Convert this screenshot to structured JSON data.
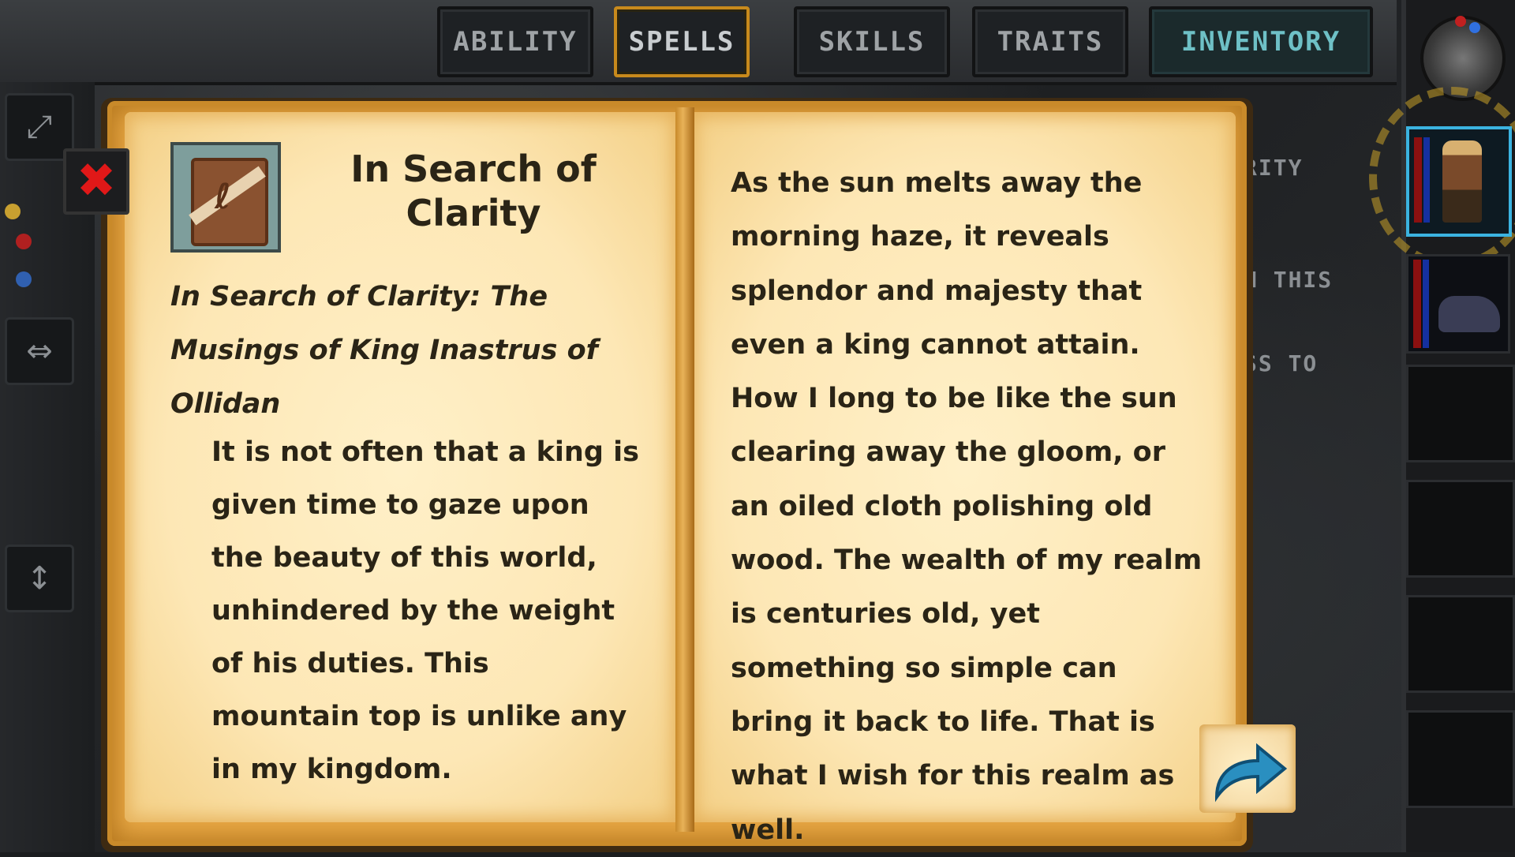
{
  "tabs": [
    {
      "label": "ABILITY",
      "active": false
    },
    {
      "label": "SPELLS",
      "active": true
    },
    {
      "label": "SKILLS",
      "active": false
    },
    {
      "label": "TRAITS",
      "active": false
    },
    {
      "label": "INVENTORY",
      "active": false
    }
  ],
  "background_panel": {
    "line1": "RITY",
    "line2": "N THIS",
    "line3": "SS TO"
  },
  "left_sidebar": {
    "expand_icon": "expand-icon",
    "resize_icon": "resize-horizontal-icon",
    "sort_icon": "sort-lines-icon"
  },
  "close_button": {
    "label": "✖",
    "icon": "close-icon",
    "color": "#e01818"
  },
  "book": {
    "icon": "book-scroll-icon",
    "title": "In Search of Clarity",
    "subtitle": "In Search of Clarity: The Musings of King Inastrus of Ollidan",
    "left_body": "It is not often that a king is given time to gaze upon the beauty of this world, unhindered by the weight of his duties. This mountain top is unlike any in my kingdom.",
    "right_body": "As the sun melts away the morning haze, it reveals splendor and majesty that even a king cannot attain. How I long to be like the sun clearing away the gloom, or an oiled cloth polishing old wood. The wealth of my realm is centuries old, yet something so simple can bring it back to life. That is what I wish for this realm as well.",
    "next_page_icon": "next-page-arrow-icon"
  },
  "colors": {
    "page": "#fde7b5",
    "cover": "#e8a845",
    "active_tab_border": "#c88a1c",
    "inventory_text": "#6ec0c6",
    "arrow": "#2a8fc0"
  }
}
